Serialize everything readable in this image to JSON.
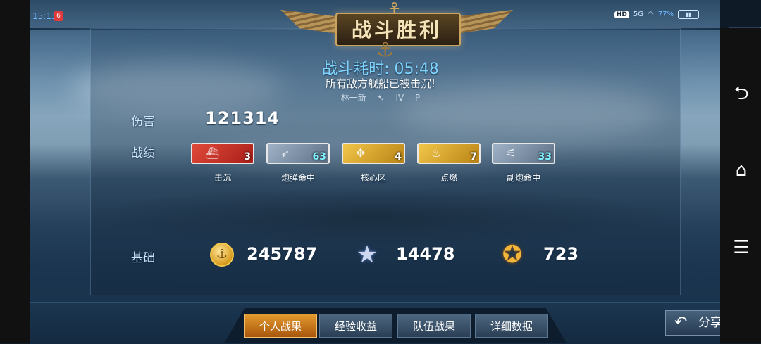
{
  "status_bar": {
    "time": "15:13",
    "app_badge": "6",
    "network_hd": "HD",
    "network_5g": "5G",
    "battery_pct": "77%"
  },
  "header": {
    "title": "战斗胜利",
    "duration_label": "战斗耗时:",
    "duration_value": "05:48",
    "result_message": "所有敌方舰船已被击沉!",
    "player_name": "林一新",
    "player_tier": "IV",
    "player_tag": "P",
    "close_icon": "close-icon"
  },
  "damage": {
    "label": "伤害",
    "value": "121314"
  },
  "achievements": {
    "label": "战绩",
    "items": [
      {
        "label": "击沉",
        "count": "3",
        "color": "#c8281f",
        "icon": "warship-icon"
      },
      {
        "label": "炮弹命中",
        "count": "63",
        "color": "#7c8fa4",
        "icon": "shell-icon"
      },
      {
        "label": "核心区",
        "count": "4",
        "color": "#e0a52a",
        "icon": "citadel-icon"
      },
      {
        "label": "点燃",
        "count": "7",
        "color": "#e0a52a",
        "icon": "fire-icon"
      },
      {
        "label": "副炮命中",
        "count": "33",
        "color": "#7c8fa4",
        "icon": "secondary-gun-icon"
      }
    ]
  },
  "base": {
    "label": "基础",
    "coins": "245787",
    "experience": "14478",
    "captain_exp": "723"
  },
  "tabs": [
    {
      "label": "个人战果",
      "active": true
    },
    {
      "label": "经验收益",
      "active": false
    },
    {
      "label": "队伍战果",
      "active": false
    },
    {
      "label": "详细数据",
      "active": false
    }
  ],
  "share": {
    "label": "分享"
  },
  "nav": {
    "back_icon": "back-icon",
    "home_icon": "home-icon",
    "menu_icon": "menu-icon"
  }
}
